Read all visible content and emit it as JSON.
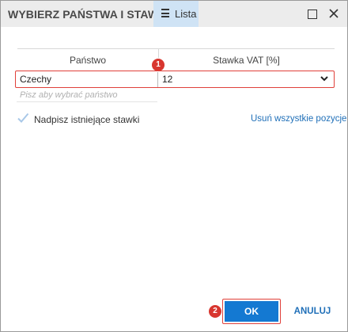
{
  "dialog": {
    "title": "WYBIERZ PAŃSTWA I STAWKI",
    "view_tab": {
      "label": "Lista",
      "icon": "menu-icon"
    },
    "window_controls": {
      "maximize_icon": "maximize-icon",
      "close_icon": "close-icon"
    }
  },
  "table": {
    "columns": [
      "Państwo",
      "Stawka VAT [%]"
    ],
    "rows": [
      {
        "country": "Czechy",
        "vat": "12"
      }
    ],
    "search_placeholder": "Pisz aby wybrać państwo",
    "search_value": ""
  },
  "options": {
    "overwrite_checkbox_label": "Nadpisz istniejące stawki",
    "overwrite_checked": true,
    "remove_all_link": "Usuń wszystkie pozycje"
  },
  "footer": {
    "ok_label": "OK",
    "cancel_label": "ANULUJ"
  },
  "annotations": {
    "badge_1": "1",
    "badge_2": "2",
    "badge_color": "#d8362f",
    "highlight_color": "#e0403a"
  },
  "colors": {
    "accent": "#1479d2",
    "link": "#1f6fb8",
    "titlebar": "#ececec",
    "active_tab": "#cfe3f5"
  }
}
